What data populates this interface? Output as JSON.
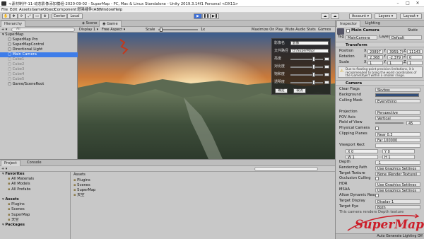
{
  "title_bar": {
    "title": "<素材制作-11-动态影像添加模组-2020-09-02 - SuperMap - PC, Mac & Linux Standalone - Unity 2019.3.14f1 Personal <DX11>"
  },
  "menu": [
    "File",
    "Edit",
    "Assets",
    "GameObject",
    "Component",
    "增强插件(AB)",
    "Window",
    "Help"
  ],
  "toolbar": {
    "center": "Center",
    "local": "Local",
    "account": "Account",
    "layers": "Layers",
    "layout": "Layout"
  },
  "hierarchy": {
    "tab": "Hierarchy",
    "create": "+ ▾",
    "search_placeholder": "All",
    "items": [
      {
        "label": "SuperMap",
        "indent": 0,
        "active": true,
        "expanded": true,
        "selected": false
      },
      {
        "label": "SuperMap Pro",
        "indent": 1,
        "active": true,
        "expanded": false,
        "selected": false
      },
      {
        "label": "SuperMapControl",
        "indent": 1,
        "active": true,
        "expanded": false,
        "selected": false
      },
      {
        "label": "Directional Light",
        "indent": 1,
        "active": true,
        "expanded": false,
        "selected": false
      },
      {
        "label": "Main Camera",
        "indent": 1,
        "active": true,
        "expanded": false,
        "selected": true
      },
      {
        "label": "Cube1",
        "indent": 1,
        "active": false,
        "expanded": false,
        "selected": false
      },
      {
        "label": "Cube2",
        "indent": 1,
        "active": false,
        "expanded": false,
        "selected": false
      },
      {
        "label": "Cube3",
        "indent": 1,
        "active": false,
        "expanded": false,
        "selected": false
      },
      {
        "label": "Cube4",
        "indent": 1,
        "active": false,
        "expanded": false,
        "selected": false
      },
      {
        "label": "Cube5",
        "indent": 1,
        "active": false,
        "expanded": false,
        "selected": false
      },
      {
        "label": "Game/SceneRoot",
        "indent": 1,
        "active": true,
        "expanded": false,
        "selected": false
      }
    ]
  },
  "scene_tabs": {
    "scene": "Scene",
    "game": "Game"
  },
  "game_bar": {
    "display": "Display 1",
    "aspect": "Free Aspect",
    "scale_label": "Scale",
    "scale_value": "1x",
    "maximize": "Maximize On Play",
    "mute": "Mute Audio",
    "stats": "Stats",
    "gizmos": "Gizmos"
  },
  "overlay_panel": {
    "fields": [
      {
        "label": "影像名",
        "value": "影像"
      },
      {
        "label": "文件路径",
        "value": "D:/SuperMap/"
      }
    ],
    "sliders": [
      {
        "label": "亮度",
        "value": 0.7
      },
      {
        "label": "对比度",
        "value": 0.7
      },
      {
        "label": "饱和度",
        "value": 0.7
      },
      {
        "label": "透明度",
        "value": 0.7
      }
    ],
    "buttons": [
      "确定",
      "取消"
    ]
  },
  "inspector": {
    "tab_inspector": "Inspector",
    "tab_lighting": "Lighting",
    "object_name": "Main Camera",
    "static": "Static",
    "tag_label": "Tag",
    "tag_value": "MainCamera",
    "layer_label": "Layer",
    "layer_value": "Default",
    "transform": {
      "title": "Transform",
      "position": {
        "label": "Position",
        "x": "20897",
        "y": "3959.7",
        "z": "11143"
      },
      "rotation": {
        "label": "Rotation",
        "x": "2.368",
        "y": "-2.379",
        "z": "0"
      },
      "scale": {
        "label": "Scale",
        "x": "1",
        "y": "1",
        "z": "1"
      },
      "warning": "Due to floating-point precision limitations, it is recommended to bring the world coordinates of the GameObject within a smaller range."
    },
    "camera": {
      "title": "Camera",
      "props": [
        {
          "label": "Clear Flags",
          "value": "Skybox",
          "kind": "drop"
        },
        {
          "label": "Background",
          "value": "",
          "kind": "color"
        },
        {
          "label": "Culling Mask",
          "value": "Everything",
          "kind": "drop"
        },
        {
          "label": "",
          "value": "",
          "kind": "gap"
        },
        {
          "label": "Projection",
          "value": "Perspective",
          "kind": "drop"
        },
        {
          "label": "FOV Axis",
          "value": "Vertical",
          "kind": "drop"
        },
        {
          "label": "Field of View",
          "value": "45",
          "kind": "slider"
        },
        {
          "label": "Physical Camera",
          "value": "",
          "kind": "check"
        },
        {
          "label": "Clipping Planes",
          "value": "Near  0.3",
          "kind": "text"
        },
        {
          "label": "",
          "value": "Far  100000",
          "kind": "text"
        },
        {
          "label": "Viewport Rect",
          "value": "",
          "kind": "text"
        },
        {
          "label": "X 0",
          "value": "Y 0",
          "kind": "pair"
        },
        {
          "label": "W 1",
          "value": "H 1",
          "kind": "pair"
        },
        {
          "label": "Depth",
          "value": "-1",
          "kind": "text"
        },
        {
          "label": "Rendering Path",
          "value": "Use Graphics Settings",
          "kind": "drop"
        },
        {
          "label": "Target Texture",
          "value": "None (Render Texture)",
          "kind": "drop"
        },
        {
          "label": "Occlusion Culling",
          "value": "",
          "kind": "check"
        },
        {
          "label": "HDR",
          "value": "Use Graphics Settings",
          "kind": "drop"
        },
        {
          "label": "MSAA",
          "value": "Use Graphics Settings",
          "kind": "drop"
        },
        {
          "label": "Allow Dynamic Reso",
          "value": "",
          "kind": "check"
        },
        {
          "label": "Target Display",
          "value": "Display 1",
          "kind": "drop"
        },
        {
          "label": "Target Eye",
          "value": "Both",
          "kind": "drop"
        }
      ],
      "info": "This camera renders Depth texture"
    },
    "footer": "Auto Generate Lighting Off"
  },
  "project": {
    "tab_project": "Project",
    "tab_console": "Console",
    "add": "+ ▾",
    "tree": [
      {
        "label": "Favorites",
        "bold": true,
        "indent": 0
      },
      {
        "label": "All Materials",
        "bold": false,
        "indent": 1
      },
      {
        "label": "All Models",
        "bold": false,
        "indent": 1
      },
      {
        "label": "All Prefabs",
        "bold": false,
        "indent": 1
      },
      {
        "label": "",
        "bold": false,
        "indent": 0
      },
      {
        "label": "Assets",
        "bold": true,
        "indent": 0
      },
      {
        "label": "Plugins",
        "bold": false,
        "indent": 1
      },
      {
        "label": "Scenes",
        "bold": false,
        "indent": 1
      },
      {
        "label": "SuperMap",
        "bold": false,
        "indent": 1
      },
      {
        "label": "天空",
        "bold": false,
        "indent": 1
      },
      {
        "label": "Packages",
        "bold": true,
        "indent": 0
      }
    ],
    "content_title": "Assets",
    "content_items": [
      "Plugins",
      "Scenes",
      "SuperMap",
      "天空"
    ]
  },
  "watermark": "SuperMap",
  "colors": {
    "accent": "#3e7de9",
    "play_blue": "#3d6fd6",
    "logo_red": "#cc1f2a"
  }
}
